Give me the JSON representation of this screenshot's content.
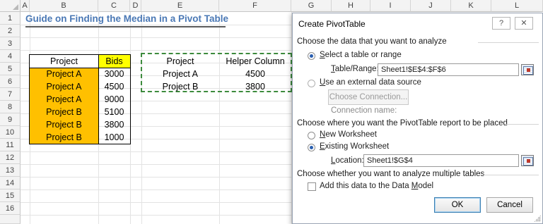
{
  "sheet": {
    "columns": [
      "A",
      "B",
      "C",
      "D",
      "E",
      "F",
      "G",
      "H",
      "I",
      "J",
      "K",
      "L"
    ],
    "rows": [
      "1",
      "2",
      "3",
      "4",
      "5",
      "6",
      "7",
      "8",
      "9",
      "10",
      "11",
      "12",
      "13",
      "14",
      "15",
      "16"
    ],
    "title": "Guide on Finding the Median in a Pivot Table",
    "table1": {
      "headers": [
        "Project",
        "Bids"
      ],
      "rows": [
        [
          "Project A",
          "3000"
        ],
        [
          "Project A",
          "4500"
        ],
        [
          "Project A",
          "9000"
        ],
        [
          "Project B",
          "5100"
        ],
        [
          "Project B",
          "3800"
        ],
        [
          "Project B",
          "1000"
        ]
      ]
    },
    "table2": {
      "headers": [
        "Project",
        "Helper Column"
      ],
      "rows": [
        [
          "Project A",
          "4500"
        ],
        [
          "Project B",
          "3800"
        ]
      ]
    }
  },
  "dialog": {
    "title": "Create PivotTable",
    "help_label": "?",
    "close_label": "✕",
    "section1": "Choose the data that you want to analyze",
    "opt_table": {
      "accel": "S",
      "rest": "elect a table or range"
    },
    "range_label": {
      "accel": "T",
      "rest": "able/Range:"
    },
    "range_value": "Sheet1!$E$4:$F$6",
    "opt_external": {
      "accel": "U",
      "rest": "se an external data source"
    },
    "choose_connection": "Choose Connection...",
    "connection_name": "Connection name:",
    "section2": "Choose where you want the PivotTable report to be placed",
    "opt_new": {
      "accel": "N",
      "rest": "ew Worksheet"
    },
    "opt_existing": {
      "accel": "E",
      "rest": "xisting Worksheet"
    },
    "location_label": {
      "accel": "L",
      "rest": "ocation:"
    },
    "location_value": "Sheet1!$G$4",
    "section3": "Choose whether you want to analyze multiple tables",
    "add_model": {
      "pre": "Add this data to the Data ",
      "accel": "M",
      "post": "odel"
    },
    "ok_label": "OK",
    "cancel_label": "Cancel"
  },
  "colors": {
    "title": "#4a78b5",
    "orange_fill": "#ffc000",
    "yellow_fill": "#ffff00",
    "dashed_border": "#3d8b3d",
    "radio_selected": "#2a5fb0"
  }
}
